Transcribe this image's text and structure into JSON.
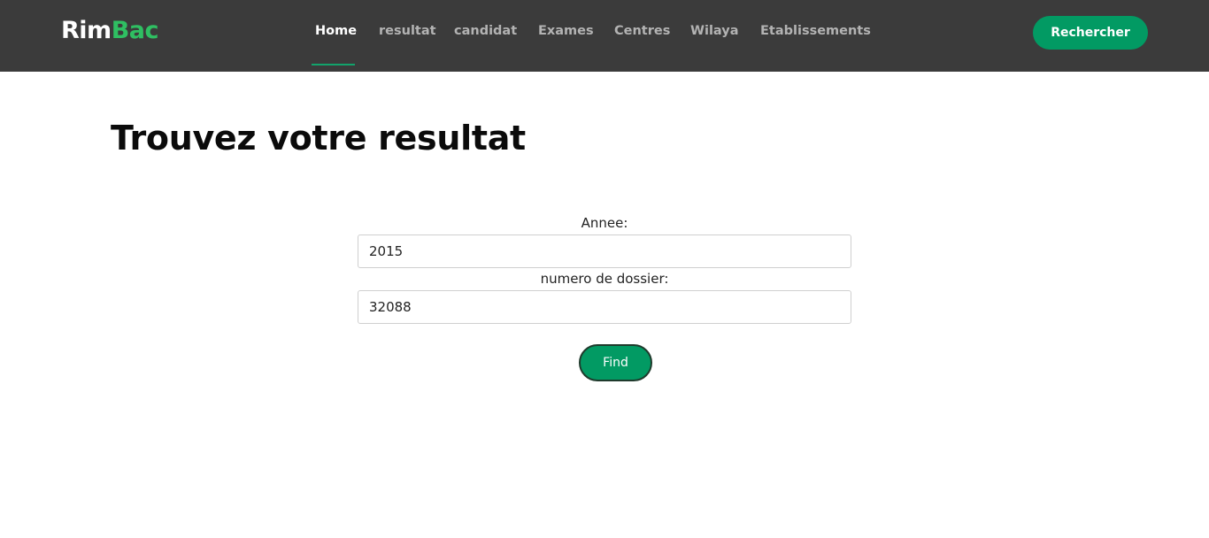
{
  "brand": {
    "part1": "Rim",
    "part2": "Bac"
  },
  "nav": {
    "items": [
      {
        "label": "Home",
        "active": true
      },
      {
        "label": "resultat"
      },
      {
        "label": "candidat"
      },
      {
        "label": "Exames"
      },
      {
        "label": "Centres"
      },
      {
        "label": "Wilaya"
      },
      {
        "label": "Etablissements"
      }
    ],
    "search_button": "Rechercher"
  },
  "page": {
    "title": "Trouvez votre resultat"
  },
  "form": {
    "annee_label": "Annee:",
    "annee_value": "2015",
    "dossier_label": "numero de dossier:",
    "dossier_value": "32088",
    "submit_label": "Find"
  },
  "colors": {
    "navbar_bg": "#3b3b3b",
    "accent_green": "#029a63",
    "logo_green": "#2fbf62"
  }
}
